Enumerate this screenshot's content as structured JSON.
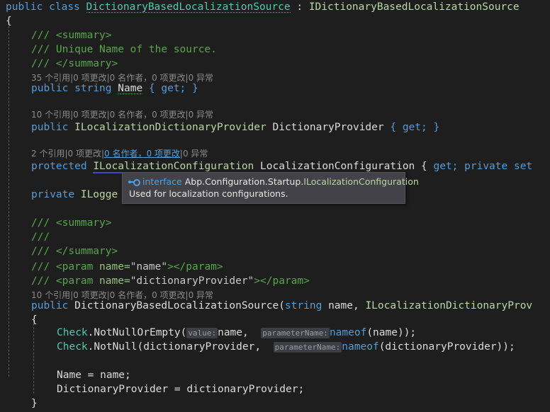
{
  "editor": {
    "background": "#1e1e1e",
    "foreground": "#dcdcdc",
    "colors": {
      "keyword": "#569cd6",
      "class_type": "#4ec9b0",
      "interface_type": "#b8d7a3",
      "comment": "#57a64a",
      "codelens": "#8a8a8a",
      "codelens_link": "#4ea0e0",
      "hint_badge_bg": "#3d3d46",
      "tooltip_bg": "#424248",
      "hover_underline": "#3f48cc",
      "squiggle": "#3c9a3c"
    }
  },
  "code": {
    "l1_public": "public",
    "l1_class": "class",
    "l1_name": "DictionaryBasedLocalizationSource",
    "l1_colon": " : ",
    "l1_base": "IDictionaryBasedLocalizationSource",
    "l2_brace": "{",
    "c1_summary_open": "/// <summary>",
    "c1_text": "/// Unique Name of the source.",
    "c1_summary_close": "/// </summary>",
    "codelens1": {
      "refs": "35 个引用",
      "sep1": "|",
      "changes": "0 项更改",
      "sep2": "|",
      "authors": "0 名作者，0 项更改",
      "sep3": "|",
      "exceptions": "0 异常"
    },
    "l_name_prop": {
      "kw1": "public",
      "kw2": "string",
      "member": "Name",
      "accessors": " { get; }"
    },
    "codelens2": {
      "refs": "10 个引用",
      "sep1": "|",
      "changes": "0 项更改",
      "sep2": "|",
      "authors": "0 名作者，0 项更改",
      "sep3": "|",
      "exceptions": "0 异常"
    },
    "l_dictprovider_prop": {
      "kw1": "public",
      "type": "ILocalizationDictionaryProvider",
      "member": "DictionaryProvider",
      "accessors": " { get; }"
    },
    "codelens3": {
      "refs": "2 个引用",
      "sep1": "|",
      "changes": "0 项更改",
      "sep2": "|",
      "authors": "0 名作者，0 项更改",
      "sep3": "|",
      "exceptions": "0 异常"
    },
    "l_localizationconfig_prop": {
      "kw1": "protected",
      "type": "ILocalizationConfiguration",
      "member": "LocalizationConfiguration",
      "accessors_open": " { ",
      "get": "get;",
      "privset": " private set"
    },
    "l_logger": {
      "kw1": "private",
      "type": "ILogge"
    },
    "c2_summary_open": "/// <summary>",
    "c2_blank": "///",
    "c2_summary_close": "/// </summary>",
    "c2_param1": {
      "slashes": "/// ",
      "open": "<param ",
      "attr": "name=",
      "value": "\"name\"",
      "close": "></param>"
    },
    "c2_param2": {
      "slashes": "/// ",
      "open": "<param ",
      "attr": "name=",
      "value": "\"dictionaryProvider\"",
      "close": "></param>"
    },
    "codelens4": {
      "refs": "10 个引用",
      "sep1": "|",
      "changes": "0 项更改",
      "sep2": "|",
      "authors": "0 名作者，0 项更改",
      "sep3": "|",
      "exceptions": "0 异常"
    },
    "l_ctor": {
      "kw1": "public",
      "name": "DictionaryBasedLocalizationSource",
      "paren": "(",
      "ptype1": "string",
      "pname1": " name, ",
      "ptype2": "ILocalizationDictionaryProv"
    },
    "l_ctor_brace": "{",
    "l_check1": {
      "cls": "Check",
      "dot": ".",
      "method": "NotNullOrEmpty",
      "paren_open": "(",
      "hint1": "value:",
      "arg1": "name, ",
      "hint2": "parameterName:",
      "nameof": "nameof",
      "arg2": "(name));"
    },
    "l_check2": {
      "cls": "Check",
      "dot": ".",
      "method": "NotNull",
      "paren_open": "(",
      "arg1": "dictionaryProvider, ",
      "hint2": "parameterName:",
      "nameof": "nameof",
      "arg2": "(dictionaryProvider));"
    },
    "l_assign1": "Name = name;",
    "l_assign2": "DictionaryProvider = dictionaryProvider;",
    "l_ctor_close": "}"
  },
  "tooltip": {
    "icon": "interface-icon",
    "keyword": "interface",
    "namespace": "Abp.Configuration.Startup.",
    "type_name": "ILocalizationConfiguration",
    "description": "Used for localization configurations."
  }
}
